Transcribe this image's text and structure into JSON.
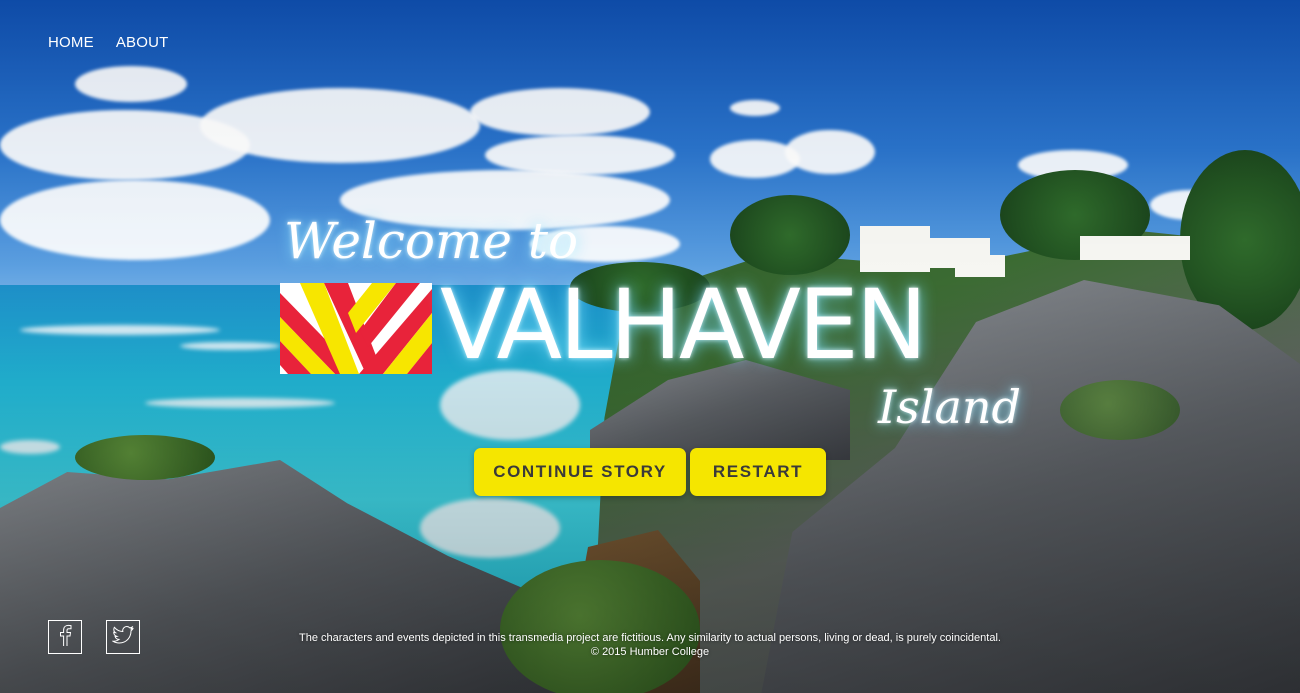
{
  "nav": {
    "items": [
      {
        "label": "HOME"
      },
      {
        "label": "ABOUT"
      }
    ]
  },
  "hero": {
    "welcome": "Welcome to",
    "brand": "VALHAVEN",
    "subtitle": "Island",
    "flag_colors": {
      "red": "#e8233a",
      "yellow": "#f7e600",
      "white": "#ffffff"
    }
  },
  "actions": {
    "continue_label": "CONTINUE STORY",
    "restart_label": "RESTART",
    "button_color": "#f5e600"
  },
  "social": {
    "facebook_icon": "facebook-icon",
    "twitter_icon": "twitter-icon"
  },
  "footer": {
    "disclaimer": "The characters and events depicted in this transmedia project are fictitious. Any similarity to actual persons, living or dead, is purely coincidental.",
    "copyright": "© 2015 Humber College"
  }
}
